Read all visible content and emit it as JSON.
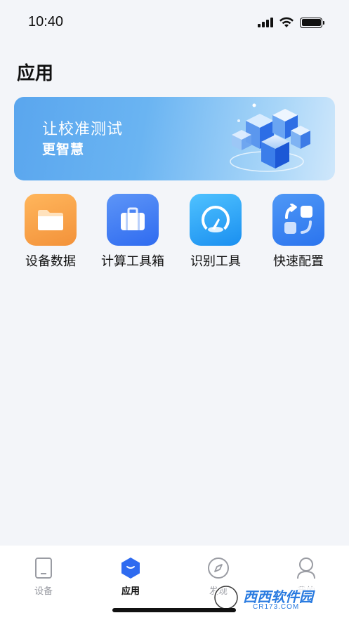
{
  "status_bar": {
    "time": "10:40"
  },
  "page": {
    "title": "应用"
  },
  "banner": {
    "line1": "让校准测试",
    "line2": "更智慧"
  },
  "apps": [
    {
      "label": "设备数据",
      "icon": "folder-icon",
      "color": "#f5a04b"
    },
    {
      "label": "计算工具箱",
      "icon": "briefcase-icon",
      "color": "#3d7cf0"
    },
    {
      "label": "识别工具",
      "icon": "gauge-icon",
      "color": "#2aa6f5"
    },
    {
      "label": "快速配置",
      "icon": "config-icon",
      "color": "#3a86f2"
    }
  ],
  "tabs": [
    {
      "label": "设备",
      "icon": "device-icon",
      "active": false
    },
    {
      "label": "应用",
      "icon": "app-icon",
      "active": true
    },
    {
      "label": "发现",
      "icon": "compass-icon",
      "active": false
    },
    {
      "label": "我的",
      "icon": "user-icon",
      "active": false
    }
  ],
  "watermark": {
    "text": "西西软件园",
    "subtext": "CR173.COM"
  },
  "colors": {
    "accent": "#2f6bf0",
    "background": "#f3f5f9"
  }
}
